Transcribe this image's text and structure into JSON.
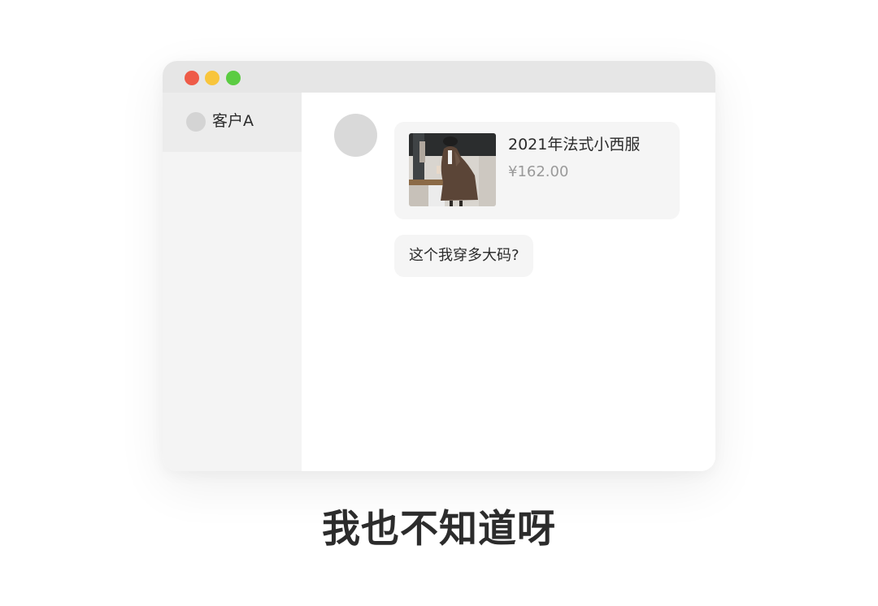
{
  "window": {
    "controls": [
      "close",
      "minimize",
      "maximize"
    ]
  },
  "sidebar": {
    "contacts": [
      {
        "name": "客户A",
        "selected": true
      }
    ]
  },
  "chat": {
    "product_card": {
      "title": "2021年法式小西服",
      "price": "¥162.00"
    },
    "message_text": "这个我穿多大码?"
  },
  "caption": "我也不知道呀",
  "colors": {
    "close": "#ee5b48",
    "minimize": "#f8c53c",
    "maximize": "#5bcc42",
    "bubble_bg": "#f5f5f5",
    "price_text": "#9a9a9a"
  }
}
